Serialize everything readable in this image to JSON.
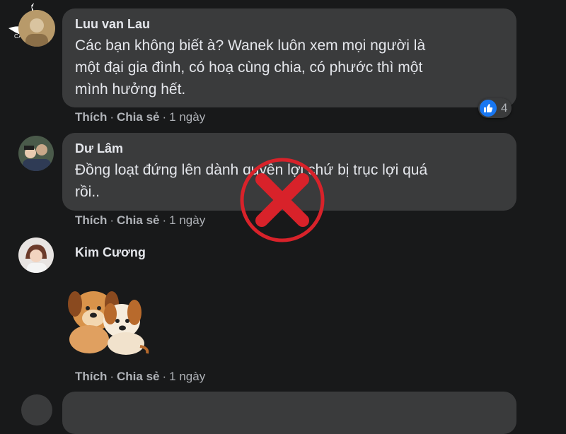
{
  "watermark": {
    "logo_text": "CANH CO"
  },
  "comments": [
    {
      "author": "Luu van Lau",
      "text_line1": "Các bạn không biết à? Wanek luôn xem mọi người là",
      "text_line2": "một đại gia đình, có hoạ cùng chia, có phước thì một",
      "text_line3": "mình hưởng hết.",
      "like": "Thích",
      "share": "Chia sẻ",
      "time": "1 ngày",
      "reaction_count": "4"
    },
    {
      "author": "Dư Lâm",
      "text_line1": "Đồng loạt đứng lên dành quyền lợi chứ bị trục lợi quá",
      "text_line2": "rồi..",
      "like": "Thích",
      "share": "Chia sẻ",
      "time": "1 ngày"
    },
    {
      "author": "Kim Cương",
      "sticker": "hugging-dogs-sticker",
      "like": "Thích",
      "share": "Chia sẻ",
      "time": "1 ngày"
    }
  ],
  "overlay": {
    "icon": "red-x-mark-icon",
    "color": "#d8222a"
  },
  "colors": {
    "background": "#18191a",
    "bubble": "#3a3b3c",
    "text": "#e4e6eb",
    "meta": "#b0b3b8",
    "like_blue": "#1877f2"
  }
}
